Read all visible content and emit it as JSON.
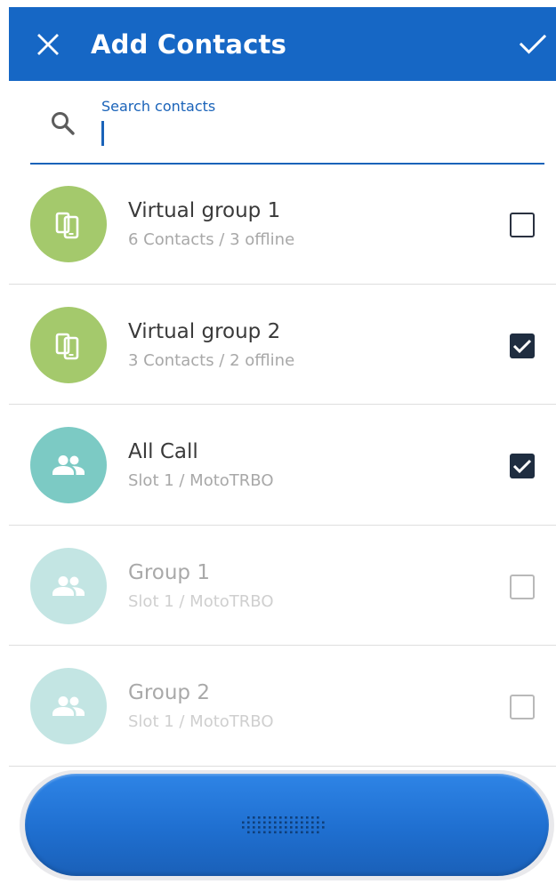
{
  "header": {
    "title": "Add Contacts",
    "close_icon": "close-icon",
    "done_icon": "check-icon"
  },
  "search": {
    "label": "Search contacts",
    "value": "",
    "icon": "search-icon"
  },
  "colors": {
    "appbar": "#1667c5",
    "accent": "#1a63b9",
    "virtual_group_avatar": "#a4c96c",
    "talkgroup_avatar": "#7ccac4",
    "talkgroup_avatar_disabled": "#c3e5e3",
    "checkbox_checked": "#1f2d40",
    "ptt_button": "#2276d8"
  },
  "contacts": [
    {
      "name": "Virtual group 1",
      "detail": "6 Contacts / 3 offline",
      "icon": "phone-group-icon",
      "checked": false,
      "enabled": true
    },
    {
      "name": "Virtual group 2",
      "detail": "3 Contacts / 2 offline",
      "icon": "phone-group-icon",
      "checked": true,
      "enabled": true
    },
    {
      "name": "All Call",
      "detail": "Slot 1 / MotoTRBO",
      "icon": "people-icon",
      "checked": true,
      "enabled": true
    },
    {
      "name": "Group 1",
      "detail": "Slot 1 / MotoTRBO",
      "icon": "people-icon",
      "checked": false,
      "enabled": false
    },
    {
      "name": "Group 2",
      "detail": "Slot 1 / MotoTRBO",
      "icon": "people-icon",
      "checked": false,
      "enabled": false
    }
  ],
  "ptt": {
    "icon": "speaker-grille-icon"
  }
}
